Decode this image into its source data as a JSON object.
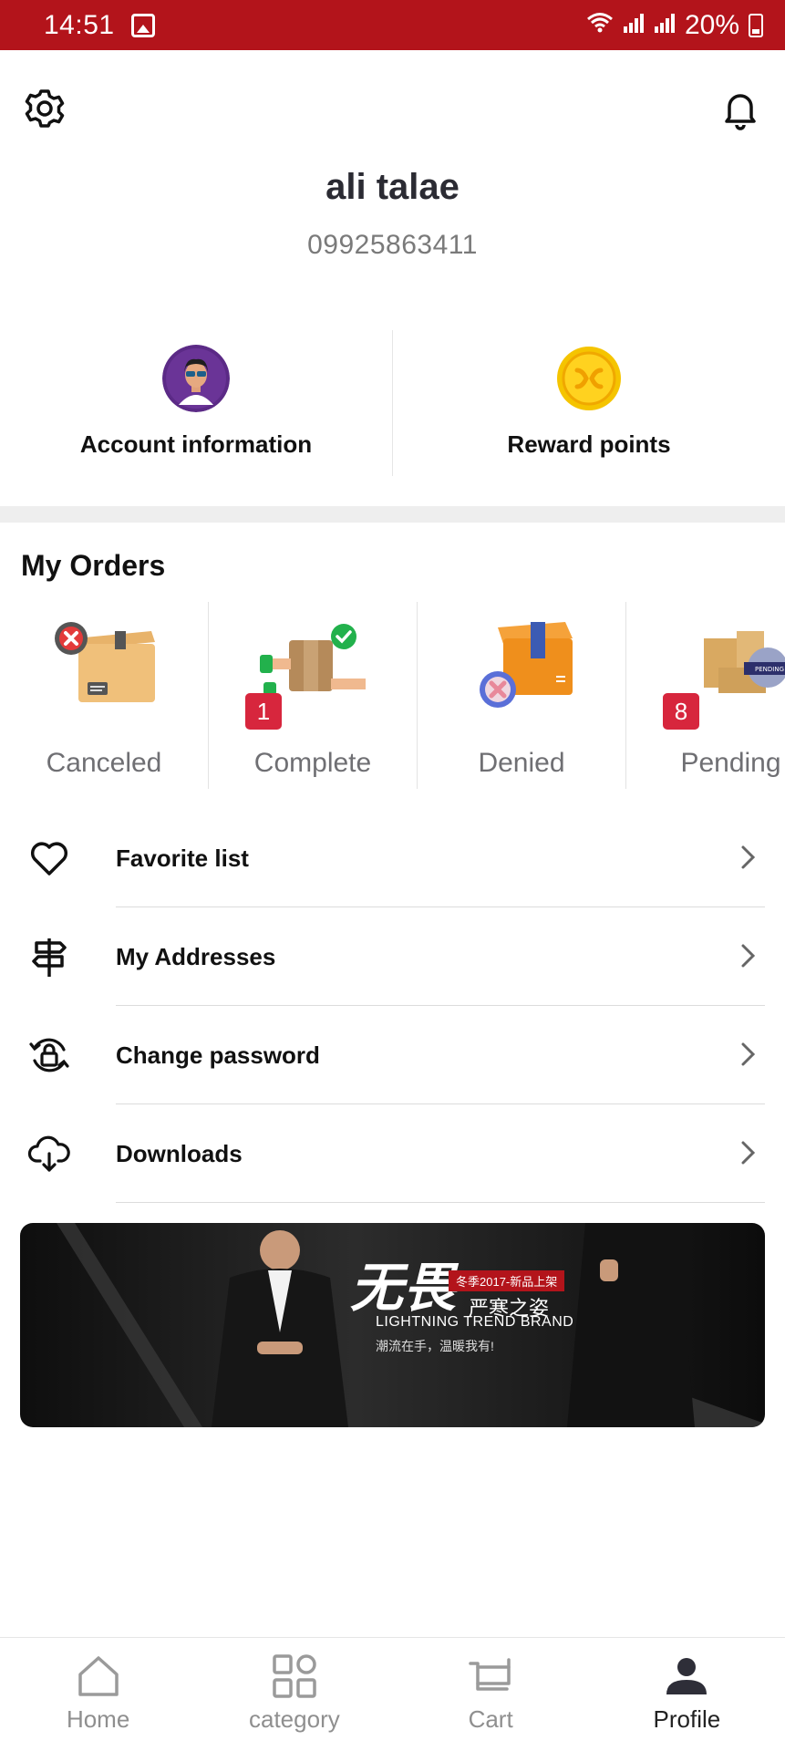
{
  "status_bar": {
    "time": "14:51",
    "battery": "20%"
  },
  "profile": {
    "name": "ali talae",
    "phone": "09925863411"
  },
  "quick_actions": [
    {
      "label": "Account information",
      "icon": "avatar-icon"
    },
    {
      "label": "Reward points",
      "icon": "coin-icon"
    }
  ],
  "orders": {
    "title": "My Orders",
    "items": [
      {
        "label": "Canceled",
        "badge": ""
      },
      {
        "label": "Complete",
        "badge": "1"
      },
      {
        "label": "Denied",
        "badge": ""
      },
      {
        "label": "Pending",
        "badge": "8"
      }
    ]
  },
  "menu": {
    "items": [
      {
        "label": "Favorite list",
        "icon": "heart-icon"
      },
      {
        "label": "My Addresses",
        "icon": "signpost-icon"
      },
      {
        "label": "Change password",
        "icon": "lock-refresh-icon"
      },
      {
        "label": "Downloads",
        "icon": "cloud-download-icon"
      }
    ]
  },
  "banner": {
    "calligraphy": "无畏",
    "tag": "冬季2017-新品上架",
    "subtitle": "严寒之姿",
    "title": "LIGHTNING TREND BRAND",
    "text": "潮流在手，温暖我有!"
  },
  "bottom_nav": {
    "items": [
      {
        "label": "Home",
        "icon": "home-icon",
        "active": false
      },
      {
        "label": "category",
        "icon": "category-icon",
        "active": false
      },
      {
        "label": "Cart",
        "icon": "cart-icon",
        "active": false
      },
      {
        "label": "Profile",
        "icon": "person-icon",
        "active": true
      }
    ]
  },
  "colors": {
    "status_bar": "#b3141b",
    "badge": "#d7263d",
    "coin": "#f5b800",
    "avatar_bg": "#5b2a86"
  }
}
